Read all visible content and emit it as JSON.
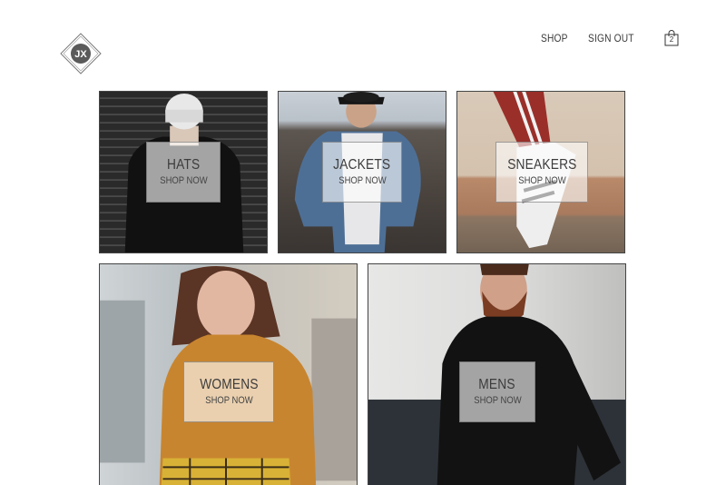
{
  "header": {
    "logo_text": "JX",
    "nav": {
      "shop": "SHOP",
      "sign_out": "SIGN OUT"
    },
    "cart": {
      "count": "2",
      "icon": "shopping-bag-icon"
    }
  },
  "categories": [
    {
      "title": "HATS",
      "cta": "SHOP NOW"
    },
    {
      "title": "JACKETS",
      "cta": "SHOP NOW"
    },
    {
      "title": "SNEAKERS",
      "cta": "SHOP NOW"
    },
    {
      "title": "WOMENS",
      "cta": "SHOP NOW"
    },
    {
      "title": "MENS",
      "cta": "SHOP NOW"
    }
  ]
}
